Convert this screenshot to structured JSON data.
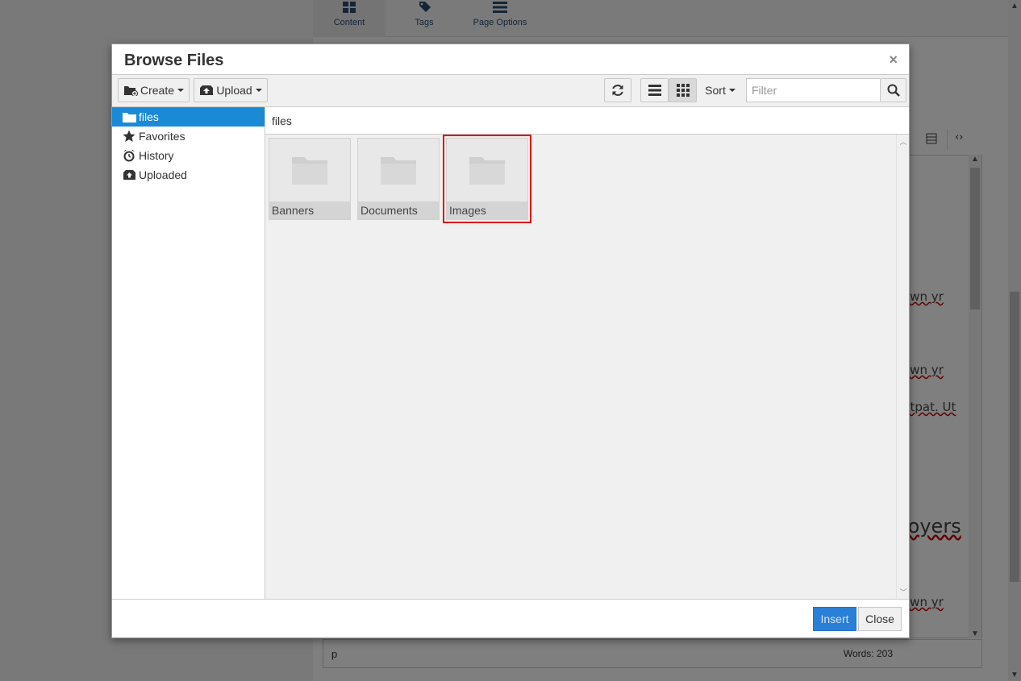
{
  "background": {
    "nav": [
      {
        "label": "Content",
        "icon": "grid-icon"
      },
      {
        "label": "Tags",
        "icon": "tag-icon"
      },
      {
        "label": "Page Options",
        "icon": "menu-icon"
      }
    ],
    "editor_fragments": [
      "own yr",
      "own yr",
      "utpat. Ut",
      "loyers",
      "own yr"
    ],
    "status_path": "p",
    "word_count": "Words: 203"
  },
  "dialog": {
    "title": "Browse Files",
    "close_glyph": "×",
    "toolbar": {
      "create_label": "Create",
      "upload_label": "Upload",
      "sort_label": "Sort",
      "filter_placeholder": "Filter"
    },
    "tree": [
      {
        "label": "files",
        "icon": "folder-icon",
        "selected": true
      },
      {
        "label": "Favorites",
        "icon": "star-icon"
      },
      {
        "label": "History",
        "icon": "alarm-clock-icon"
      },
      {
        "label": "Uploaded",
        "icon": "upload-icon"
      }
    ],
    "path": "files",
    "folders": [
      {
        "name": "Banners"
      },
      {
        "name": "Documents"
      },
      {
        "name": "Images",
        "highlighted": true
      }
    ],
    "footer": {
      "insert_label": "Insert",
      "close_label": "Close"
    }
  },
  "colors": {
    "selection": "#1a8ad6",
    "insert_button": "#2a7fd6",
    "highlight": "#d11111"
  }
}
